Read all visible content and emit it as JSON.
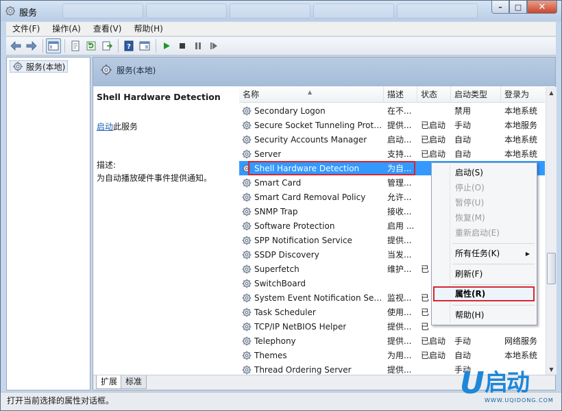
{
  "window": {
    "title": "服务"
  },
  "menubar": {
    "items": [
      "文件(F)",
      "操作(A)",
      "查看(V)",
      "帮助(H)"
    ]
  },
  "tree": {
    "root_label": "服务(本地)"
  },
  "main": {
    "header_label": "服务(本地)",
    "selected_service_title": "Shell Hardware Detection",
    "start_link": "启动",
    "start_link_suffix": "此服务",
    "desc_label": "描述:",
    "desc_text": "为自动播放硬件事件提供通知。"
  },
  "list": {
    "columns": [
      "名称",
      "描述",
      "状态",
      "启动类型",
      "登录为"
    ],
    "rows": [
      {
        "name": "Secondary Logon",
        "desc": "在不...",
        "status": "",
        "start": "禁用",
        "logon": "本地系统"
      },
      {
        "name": "Secure Socket Tunneling Proto...",
        "desc": "提供...",
        "status": "已启动",
        "start": "手动",
        "logon": "本地服务"
      },
      {
        "name": "Security Accounts Manager",
        "desc": "启动...",
        "status": "已启动",
        "start": "自动",
        "logon": "本地系统"
      },
      {
        "name": "Server",
        "desc": "支持...",
        "status": "已启动",
        "start": "自动",
        "logon": "本地系统"
      },
      {
        "name": "Shell Hardware Detection",
        "desc": "为自...",
        "status": "",
        "start": "",
        "logon": ""
      },
      {
        "name": "Smart Card",
        "desc": "管理...",
        "status": "",
        "start": "",
        "logon": ""
      },
      {
        "name": "Smart Card Removal Policy",
        "desc": "允许...",
        "status": "",
        "start": "",
        "logon": ""
      },
      {
        "name": "SNMP Trap",
        "desc": "接收...",
        "status": "",
        "start": "",
        "logon": ""
      },
      {
        "name": "Software Protection",
        "desc": "启用 ...",
        "status": "",
        "start": "",
        "logon": ""
      },
      {
        "name": "SPP Notification Service",
        "desc": "提供...",
        "status": "",
        "start": "",
        "logon": ""
      },
      {
        "name": "SSDP Discovery",
        "desc": "当发...",
        "status": "",
        "start": "",
        "logon": ""
      },
      {
        "name": "Superfetch",
        "desc": "维护...",
        "status": "已",
        "start": "",
        "logon": ""
      },
      {
        "name": "SwitchBoard",
        "desc": "",
        "status": "",
        "start": "",
        "logon": ""
      },
      {
        "name": "System Event Notification Servi...",
        "desc": "监视...",
        "status": "已",
        "start": "",
        "logon": ""
      },
      {
        "name": "Task Scheduler",
        "desc": "使用...",
        "status": "已",
        "start": "",
        "logon": ""
      },
      {
        "name": "TCP/IP NetBIOS Helper",
        "desc": "提供...",
        "status": "已",
        "start": "",
        "logon": ""
      },
      {
        "name": "Telephony",
        "desc": "提供...",
        "status": "已启动",
        "start": "手动",
        "logon": "网络服务"
      },
      {
        "name": "Themes",
        "desc": "为用...",
        "status": "已启动",
        "start": "自动",
        "logon": "本地系统"
      },
      {
        "name": "Thread Ordering Server",
        "desc": "提供...",
        "status": "",
        "start": "手动",
        "logon": ""
      }
    ]
  },
  "context_menu": {
    "start": "启动(S)",
    "stop": "停止(O)",
    "pause": "暂停(U)",
    "resume": "恢复(M)",
    "restart": "重新启动(E)",
    "all_tasks": "所有任务(K)",
    "refresh": "刷新(F)",
    "properties": "属性(R)",
    "help": "帮助(H)"
  },
  "tabs": {
    "extended": "扩展",
    "standard": "标准"
  },
  "statusbar": {
    "text": "打开当前选择的属性对话框。"
  },
  "watermark": {
    "letter": "U",
    "brand": "启动",
    "url": "WWW.UQIDONG.COM"
  },
  "colors": {
    "selection": "#3399ff",
    "highlight_box": "#d8262f",
    "link": "#1a5fb4"
  }
}
